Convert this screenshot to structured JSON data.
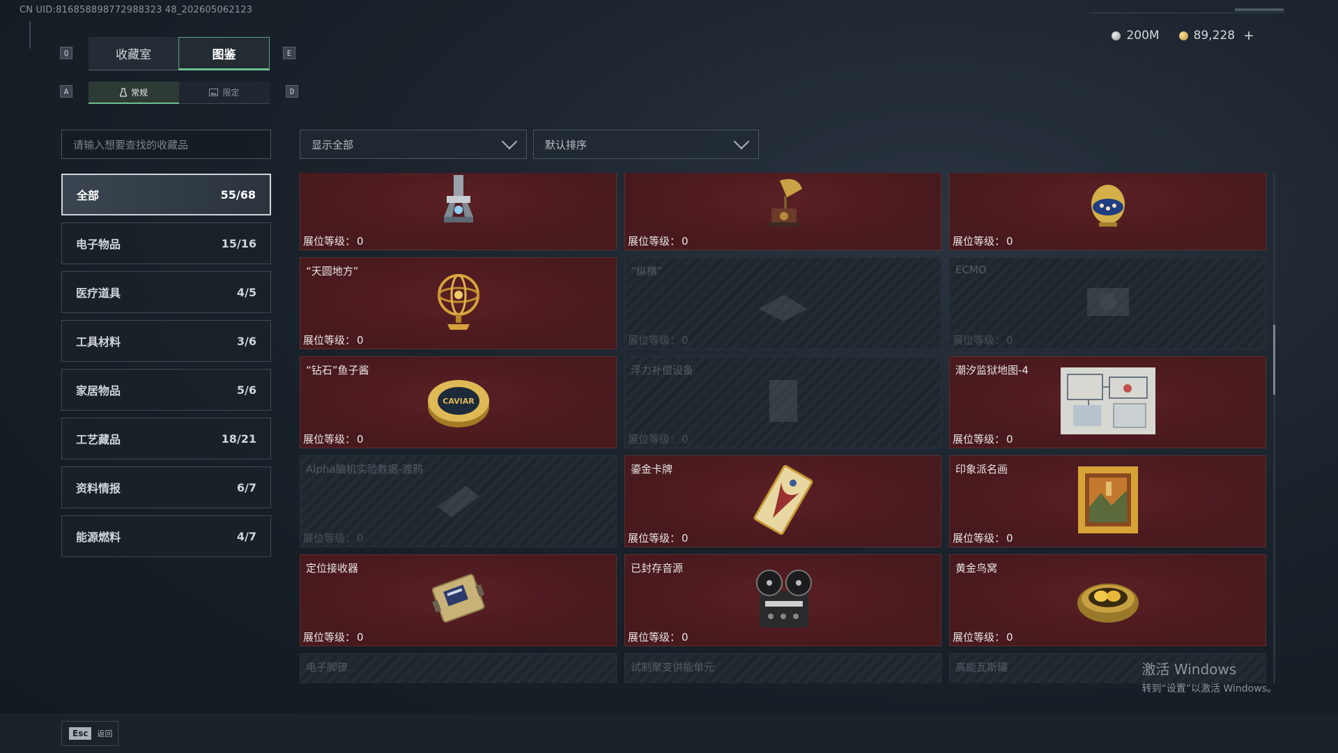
{
  "uid": "CN UID:816858898772988323 48_202605062123",
  "currency": {
    "silver": "200M",
    "gold": "89,228",
    "add": "+"
  },
  "hints": {
    "prev_tab": "Q",
    "next_tab": "E",
    "prev_sub": "A",
    "next_sub": "D"
  },
  "tabs": [
    {
      "label": "收藏室"
    },
    {
      "label": "图鉴"
    }
  ],
  "subtabs": [
    {
      "label": "常规"
    },
    {
      "label": "限定"
    }
  ],
  "search": {
    "placeholder": "请输入想要查找的收藏品"
  },
  "filter": {
    "label": "显示全部"
  },
  "sort": {
    "label": "默认排序"
  },
  "categories": [
    {
      "label": "全部",
      "count": "55/68"
    },
    {
      "label": "电子物品",
      "count": "15/16"
    },
    {
      "label": "医疗道具",
      "count": "4/5"
    },
    {
      "label": "工具材料",
      "count": "3/6"
    },
    {
      "label": "家居物品",
      "count": "5/6"
    },
    {
      "label": "工艺藏品",
      "count": "18/21"
    },
    {
      "label": "资料情报",
      "count": "6/7"
    },
    {
      "label": "能源燃料",
      "count": "4/7"
    }
  ],
  "level_label": "展位等级：",
  "cards": [
    {
      "name": "",
      "level": "0",
      "locked": false,
      "icon": "robot-arm-icon"
    },
    {
      "name": "",
      "level": "0",
      "locked": false,
      "icon": "gramophone-icon"
    },
    {
      "name": "",
      "level": "0",
      "locked": false,
      "icon": "jeweled-egg-icon"
    },
    {
      "name": "“天圆地方”",
      "level": "0",
      "locked": false,
      "icon": "armillary-sphere-icon"
    },
    {
      "name": "“纵横”",
      "level": "0",
      "locked": true,
      "icon": "chessboard-icon"
    },
    {
      "name": "ECMO",
      "level": "0",
      "locked": true,
      "icon": "ecmo-machine-icon"
    },
    {
      "name": "“钻石”鱼子酱",
      "level": "0",
      "locked": false,
      "icon": "caviar-tin-icon"
    },
    {
      "name": "浮力补偿设备",
      "level": "0",
      "locked": true,
      "icon": "buoyancy-device-icon"
    },
    {
      "name": "潮汐监狱地图-4",
      "level": "0",
      "locked": false,
      "icon": "prison-map-icon"
    },
    {
      "name": "Alpha脑机实验数据-渡鸦",
      "level": "0",
      "locked": true,
      "icon": "data-drive-icon"
    },
    {
      "name": "鎏金卡牌",
      "level": "0",
      "locked": false,
      "icon": "gold-card-icon"
    },
    {
      "name": "印象派名画",
      "level": "0",
      "locked": false,
      "icon": "painting-icon"
    },
    {
      "name": "定位接收器",
      "level": "0",
      "locked": false,
      "icon": "locator-receiver-icon"
    },
    {
      "name": "已封存音源",
      "level": "0",
      "locked": false,
      "icon": "reel-recorder-icon"
    },
    {
      "name": "黄金鸟窝",
      "level": "0",
      "locked": false,
      "icon": "golden-nest-icon"
    },
    {
      "name": "电子脚镣",
      "level": "",
      "locked": true,
      "icon": "ankle-monitor-icon"
    },
    {
      "name": "试制聚变供能单元",
      "level": "",
      "locked": true,
      "icon": "fusion-cell-icon"
    },
    {
      "name": "高能瓦斯罐",
      "level": "",
      "locked": true,
      "icon": "gas-tank-icon"
    }
  ],
  "footer": {
    "key": "Esc",
    "label": "返回"
  },
  "watermark": {
    "title": "激活 Windows",
    "subtitle": "转到“设置”以激活 Windows。"
  }
}
